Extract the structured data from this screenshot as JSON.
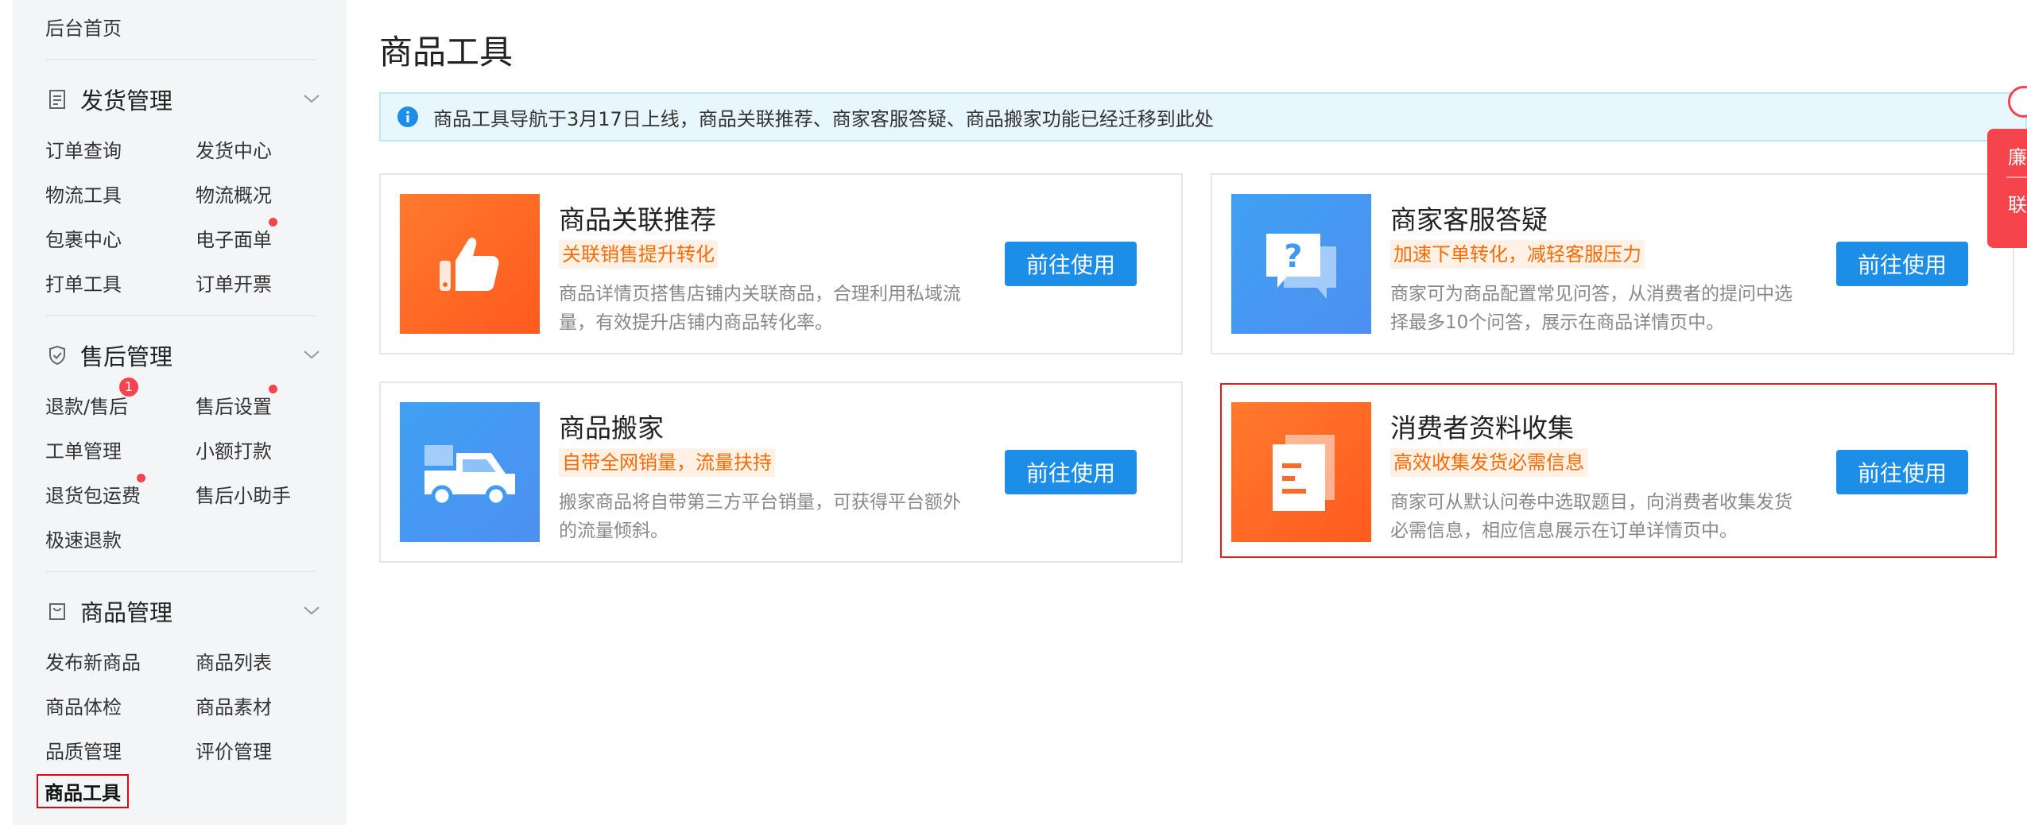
{
  "sidebar": {
    "home": "后台首页",
    "sections": [
      {
        "title": "发货管理",
        "items": [
          "订单查询",
          "发货中心",
          "物流工具",
          "物流概况",
          "包裹中心",
          "电子面单",
          "打单工具",
          "订单开票"
        ]
      },
      {
        "title": "售后管理",
        "items": [
          "退款/售后",
          "售后设置",
          "工单管理",
          "小额打款",
          "退货包运费",
          "售后小助手",
          "极速退款"
        ],
        "badge_count": "1"
      },
      {
        "title": "商品管理",
        "items": [
          "发布新商品",
          "商品列表",
          "商品体检",
          "商品素材",
          "品质管理",
          "评价管理",
          "商品工具"
        ]
      }
    ]
  },
  "main": {
    "title": "商品工具",
    "notice": "商品工具导航于3月17日上线，商品关联推荐、商家客服答疑、商品搬家功能已经迁移到此处",
    "button_label": "前往使用",
    "cards": [
      {
        "title": "商品关联推荐",
        "tag": "关联销售提升转化",
        "desc": "商品详情页搭售店铺内关联商品，合理利用私域流量，有效提升店铺内商品转化率。",
        "icon": "thumbs-up-icon",
        "color": "#ff6a2a"
      },
      {
        "title": "商家客服答疑",
        "tag": "加速下单转化，减轻客服压力",
        "desc": "商家可为商品配置常见问答，从消费者的提问中选择最多10个问答，展示在商品详情页中。",
        "icon": "question-chat-icon",
        "color": "#3f9af2"
      },
      {
        "title": "商品搬家",
        "tag": "自带全网销量，流量扶持",
        "desc": "搬家商品将自带第三方平台销量，可获得平台额外的流量倾斜。",
        "icon": "truck-icon",
        "color": "#3f9af2"
      },
      {
        "title": "消费者资料收集",
        "tag": "高效收集发货必需信息",
        "desc": "商家可从默认问卷中选取题目，向消费者收集发货必需信息，相应信息展示在订单详情页中。",
        "icon": "document-icon",
        "color": "#ff6a2a"
      }
    ]
  },
  "float_widget": {
    "line1": "廉",
    "line2": "联"
  }
}
